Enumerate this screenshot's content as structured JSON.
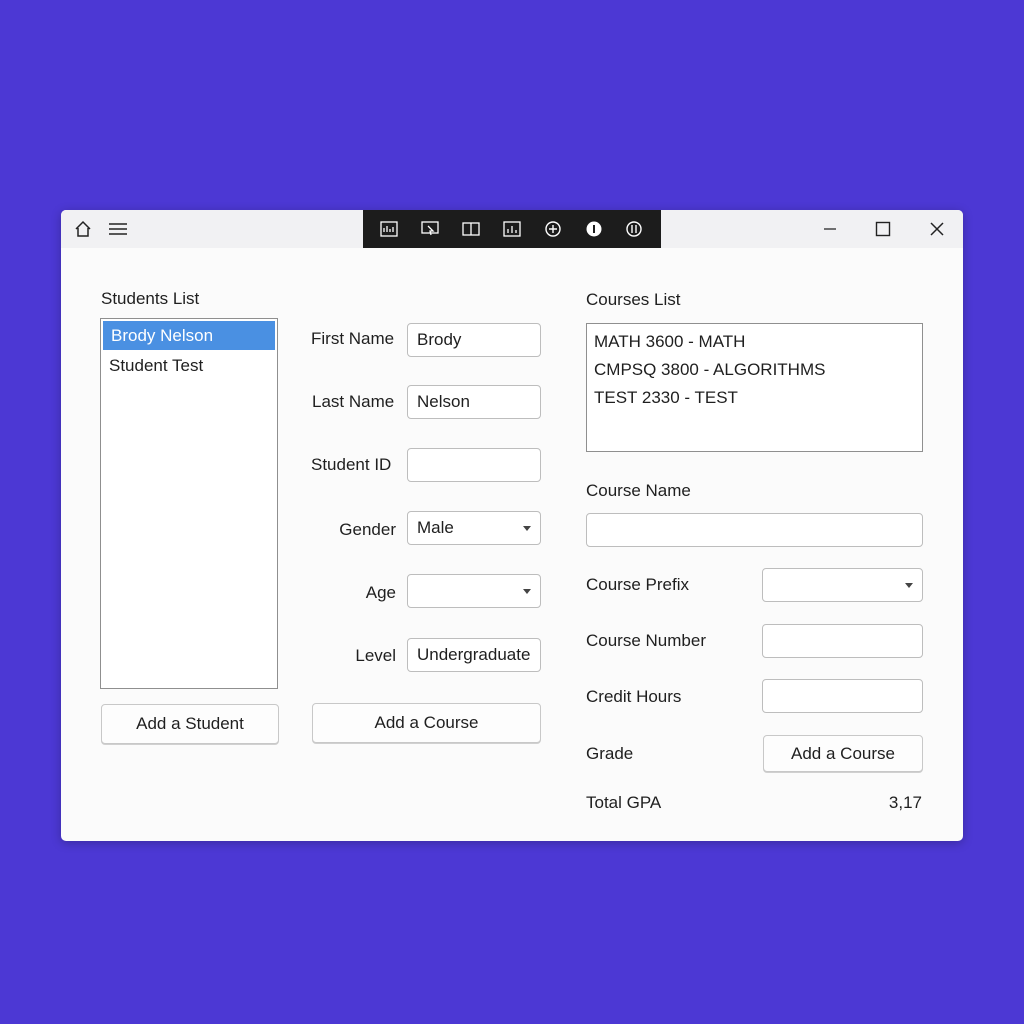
{
  "window": {
    "students_list_title": "Students List",
    "courses_list_title": "Courses List"
  },
  "students": [
    {
      "name": "Brody Nelson",
      "selected": true
    },
    {
      "name": "Student Test",
      "selected": false
    }
  ],
  "form": {
    "first_name_label": "First Name",
    "first_name_value": "Brody",
    "last_name_label": "Last Name",
    "last_name_value": "Nelson",
    "student_id_label": "Student ID",
    "student_id_value": "",
    "gender_label": "Gender",
    "gender_value": "Male",
    "age_label": "Age",
    "age_value": "",
    "level_label": "Level",
    "level_value": "Undergraduate"
  },
  "courses": [
    "MATH 3600 - MATH",
    "CMPSQ 3800 - ALGORITHMS",
    "TEST 2330 - TEST"
  ],
  "course_form": {
    "course_name_label": "Course Name",
    "course_name_value": "",
    "course_prefix_label": "Course Prefix",
    "course_prefix_value": "",
    "course_number_label": "Course Number",
    "course_number_value": "",
    "credit_hours_label": "Credit Hours",
    "credit_hours_value": "",
    "grade_label": "Grade",
    "total_gpa_label": "Total GPA",
    "total_gpa_value": "3,17"
  },
  "buttons": {
    "add_student": "Add a Student",
    "add_course_left": "Add a Course",
    "add_course_right": "Add a Course"
  },
  "icons": {
    "home": "home-icon",
    "menu": "hamburger-menu-icon",
    "minimize": "minimize-icon",
    "maximize": "maximize-icon",
    "close": "close-icon"
  }
}
